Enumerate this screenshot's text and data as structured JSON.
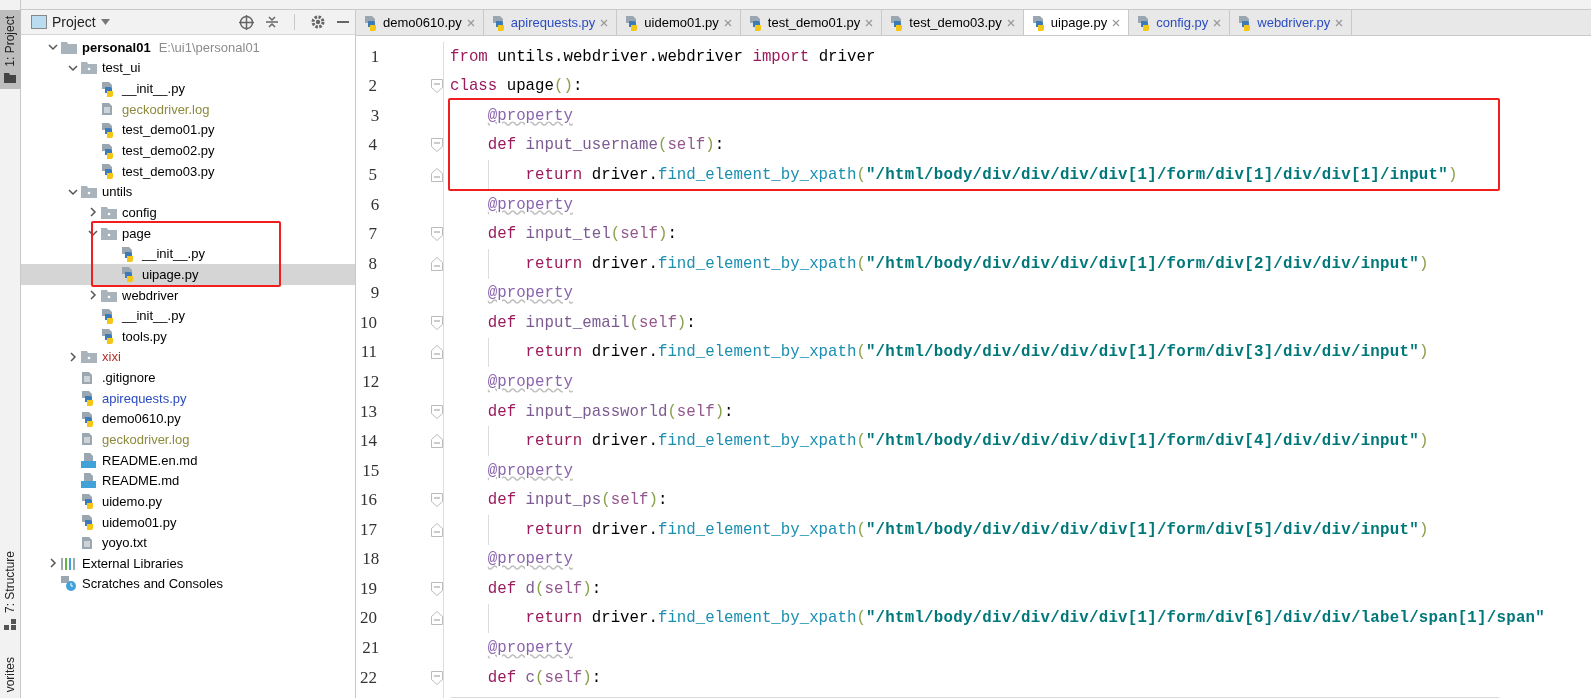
{
  "tool_stripe": [
    {
      "label": "1: Project",
      "selected": true
    },
    {
      "label": "7: Structure",
      "selected": false
    },
    {
      "label": "vorites",
      "selected": false
    }
  ],
  "project": {
    "title": "Project",
    "tree": [
      {
        "label": "personal01",
        "hint": "E:\\ui1\\personal01",
        "kind": "module",
        "expanded": true,
        "selected": false,
        "children": [
          {
            "label": "test_ui",
            "kind": "folder",
            "expanded": true,
            "selected": false,
            "children": [
              {
                "label": "__init__.py",
                "kind": "python",
                "selected": false
              },
              {
                "label": "geckodriver.log",
                "kind": "text",
                "color": "#8c8a3c",
                "selected": false
              },
              {
                "label": "test_demo01.py",
                "kind": "python",
                "selected": false
              },
              {
                "label": "test_demo02.py",
                "kind": "python",
                "selected": false
              },
              {
                "label": "test_demo03.py",
                "kind": "python",
                "selected": false
              }
            ]
          },
          {
            "label": "untils",
            "kind": "folder",
            "expanded": true,
            "selected": false,
            "children": [
              {
                "label": "config",
                "kind": "folder",
                "expanded": false,
                "selected": false
              },
              {
                "label": "page",
                "kind": "folder",
                "expanded": true,
                "selected": false,
                "boxed": true,
                "children": [
                  {
                    "label": "__init__.py",
                    "kind": "python",
                    "selected": false
                  },
                  {
                    "label": "uipage.py",
                    "kind": "python",
                    "selected": true
                  }
                ]
              },
              {
                "label": "webdriver",
                "kind": "folder",
                "expanded": false,
                "selected": false
              },
              {
                "label": "__init__.py",
                "kind": "python",
                "selected": false
              },
              {
                "label": "tools.py",
                "kind": "python",
                "selected": false
              }
            ]
          },
          {
            "label": "xixi",
            "kind": "folder",
            "expanded": false,
            "color": "#b3302b",
            "selected": false
          },
          {
            "label": ".gitignore",
            "kind": "text",
            "selected": false
          },
          {
            "label": "apirequests.py",
            "kind": "python",
            "color": "#2a4cc0",
            "selected": false
          },
          {
            "label": "demo0610.py",
            "kind": "python",
            "selected": false
          },
          {
            "label": "geckodriver.log",
            "kind": "text",
            "color": "#8c8a3c",
            "selected": false
          },
          {
            "label": "README.en.md",
            "kind": "markdown",
            "selected": false
          },
          {
            "label": "README.md",
            "kind": "markdown",
            "selected": false
          },
          {
            "label": "uidemo.py",
            "kind": "python",
            "selected": false
          },
          {
            "label": "uidemo01.py",
            "kind": "python",
            "selected": false
          },
          {
            "label": "yoyo.txt",
            "kind": "text",
            "selected": false
          }
        ]
      },
      {
        "label": "External Libraries",
        "kind": "libraries",
        "expanded": false,
        "selected": false
      },
      {
        "label": "Scratches and Consoles",
        "kind": "scratches",
        "selected": false
      }
    ]
  },
  "editor_tabs": [
    {
      "label": "demo0610.py",
      "selected": false
    },
    {
      "label": "apirequests.py",
      "selected": false,
      "color": "#2a4cc0"
    },
    {
      "label": "uidemo01.py",
      "selected": false
    },
    {
      "label": "test_demo01.py",
      "selected": false
    },
    {
      "label": "test_demo03.py",
      "selected": false
    },
    {
      "label": "uipage.py",
      "selected": true
    },
    {
      "label": "config.py",
      "selected": false,
      "color": "#2a4cc0"
    },
    {
      "label": "webdriver.py",
      "selected": false,
      "color": "#2a4cc0"
    }
  ],
  "editor": {
    "lines": [
      {
        "number": "1",
        "tokens": [
          {
            "kind": "keyword",
            "text": "from"
          },
          {
            "kind": "plain",
            "text": " untils.webdriver.webdriver "
          },
          {
            "kind": "keyword",
            "text": "import"
          },
          {
            "kind": "plain",
            "text": " driver"
          }
        ]
      },
      {
        "number": "2",
        "kind": "opener",
        "tokens": [
          {
            "kind": "keyword",
            "text": "class"
          },
          {
            "kind": "plain",
            "text": " upage"
          },
          {
            "kind": "paren",
            "text": "()"
          },
          {
            "kind": "plain",
            "text": ":"
          }
        ],
        "children": [
          {
            "number": "3",
            "boxed": true,
            "tokens": [
              {
                "kind": "decorator",
                "text": "@property"
              }
            ]
          },
          {
            "number": "4",
            "boxed": true,
            "kind": "opener",
            "tokens": [
              {
                "kind": "keyword",
                "text": "def"
              },
              {
                "kind": "name",
                "text": " input_username"
              },
              {
                "kind": "paren",
                "text": "("
              },
              {
                "kind": "self",
                "text": "self"
              },
              {
                "kind": "paren",
                "text": ")"
              },
              {
                "kind": "plain",
                "text": ":"
              }
            ],
            "children": [
              {
                "number": "5",
                "boxed": true,
                "kind": "closer",
                "tokens": [
                  {
                    "kind": "keyword",
                    "text": "return"
                  },
                  {
                    "kind": "plain",
                    "text": " driver."
                  },
                  {
                    "kind": "call",
                    "text": "find_element_by_xpath"
                  },
                  {
                    "kind": "paren",
                    "text": "("
                  },
                  {
                    "kind": "string",
                    "text": "\"/html/body/div/div/div/div[1]/form/div[1]/div/div[1]/input\""
                  },
                  {
                    "kind": "paren",
                    "text": ")"
                  }
                ]
              }
            ]
          },
          {
            "number": "6",
            "tokens": [
              {
                "kind": "decorator",
                "text": "@property"
              }
            ]
          },
          {
            "number": "7",
            "kind": "opener",
            "tokens": [
              {
                "kind": "keyword",
                "text": "def"
              },
              {
                "kind": "name",
                "text": " input_tel"
              },
              {
                "kind": "paren",
                "text": "("
              },
              {
                "kind": "self",
                "text": "self"
              },
              {
                "kind": "paren",
                "text": ")"
              },
              {
                "kind": "plain",
                "text": ":"
              }
            ],
            "children": [
              {
                "number": "8",
                "kind": "closer",
                "tokens": [
                  {
                    "kind": "keyword",
                    "text": "return"
                  },
                  {
                    "kind": "plain",
                    "text": " driver."
                  },
                  {
                    "kind": "call",
                    "text": "find_element_by_xpath"
                  },
                  {
                    "kind": "paren",
                    "text": "("
                  },
                  {
                    "kind": "string",
                    "text": "\"/html/body/div/div/div/div[1]/form/div[2]/div/div/input\""
                  },
                  {
                    "kind": "paren",
                    "text": ")"
                  }
                ]
              }
            ]
          },
          {
            "number": "9",
            "tokens": [
              {
                "kind": "decorator",
                "text": "@property"
              }
            ]
          },
          {
            "number": "10",
            "kind": "opener",
            "tokens": [
              {
                "kind": "keyword",
                "text": "def"
              },
              {
                "kind": "name",
                "text": " input_email"
              },
              {
                "kind": "paren",
                "text": "("
              },
              {
                "kind": "self",
                "text": "self"
              },
              {
                "kind": "paren",
                "text": ")"
              },
              {
                "kind": "plain",
                "text": ":"
              }
            ],
            "children": [
              {
                "number": "11",
                "kind": "closer",
                "tokens": [
                  {
                    "kind": "keyword",
                    "text": "return"
                  },
                  {
                    "kind": "plain",
                    "text": " driver."
                  },
                  {
                    "kind": "call",
                    "text": "find_element_by_xpath"
                  },
                  {
                    "kind": "paren",
                    "text": "("
                  },
                  {
                    "kind": "string",
                    "text": "\"/html/body/div/div/div/div[1]/form/div[3]/div/div/input\""
                  },
                  {
                    "kind": "paren",
                    "text": ")"
                  }
                ]
              }
            ]
          },
          {
            "number": "12",
            "tokens": [
              {
                "kind": "decorator",
                "text": "@property"
              }
            ]
          },
          {
            "number": "13",
            "kind": "opener",
            "tokens": [
              {
                "kind": "keyword",
                "text": "def"
              },
              {
                "kind": "name",
                "text": " input_passworld"
              },
              {
                "kind": "paren",
                "text": "("
              },
              {
                "kind": "self",
                "text": "self"
              },
              {
                "kind": "paren",
                "text": ")"
              },
              {
                "kind": "plain",
                "text": ":"
              }
            ],
            "children": [
              {
                "number": "14",
                "kind": "closer",
                "tokens": [
                  {
                    "kind": "keyword",
                    "text": "return"
                  },
                  {
                    "kind": "plain",
                    "text": " driver."
                  },
                  {
                    "kind": "call",
                    "text": "find_element_by_xpath"
                  },
                  {
                    "kind": "paren",
                    "text": "("
                  },
                  {
                    "kind": "string",
                    "text": "\"/html/body/div/div/div/div[1]/form/div[4]/div/div/input\""
                  },
                  {
                    "kind": "paren",
                    "text": ")"
                  }
                ]
              }
            ]
          },
          {
            "number": "15",
            "tokens": [
              {
                "kind": "decorator",
                "text": "@property"
              }
            ]
          },
          {
            "number": "16",
            "kind": "opener",
            "tokens": [
              {
                "kind": "keyword",
                "text": "def"
              },
              {
                "kind": "name",
                "text": " input_ps"
              },
              {
                "kind": "paren",
                "text": "("
              },
              {
                "kind": "self",
                "text": "self"
              },
              {
                "kind": "paren",
                "text": ")"
              },
              {
                "kind": "plain",
                "text": ":"
              }
            ],
            "children": [
              {
                "number": "17",
                "kind": "closer",
                "tokens": [
                  {
                    "kind": "keyword",
                    "text": "return"
                  },
                  {
                    "kind": "plain",
                    "text": " driver."
                  },
                  {
                    "kind": "call",
                    "text": "find_element_by_xpath"
                  },
                  {
                    "kind": "paren",
                    "text": "("
                  },
                  {
                    "kind": "string",
                    "text": "\"/html/body/div/div/div/div[1]/form/div[5]/div/div/input\""
                  },
                  {
                    "kind": "paren",
                    "text": ")"
                  }
                ]
              }
            ]
          },
          {
            "number": "18",
            "tokens": [
              {
                "kind": "decorator",
                "text": "@property"
              }
            ]
          },
          {
            "number": "19",
            "kind": "opener",
            "tokens": [
              {
                "kind": "keyword",
                "text": "def"
              },
              {
                "kind": "name",
                "text": " d"
              },
              {
                "kind": "paren",
                "text": "("
              },
              {
                "kind": "self",
                "text": "self"
              },
              {
                "kind": "paren",
                "text": ")"
              },
              {
                "kind": "plain",
                "text": ":"
              }
            ],
            "children": [
              {
                "number": "20",
                "kind": "closer",
                "tokens": [
                  {
                    "kind": "keyword",
                    "text": "return"
                  },
                  {
                    "kind": "plain",
                    "text": " driver."
                  },
                  {
                    "kind": "call",
                    "text": "find_element_by_xpath"
                  },
                  {
                    "kind": "paren",
                    "text": "("
                  },
                  {
                    "kind": "string",
                    "text": "\"/html/body/div/div/div/div[1]/form/div[6]/div/div/label/span[1]/span\""
                  }
                ]
              }
            ]
          },
          {
            "number": "21",
            "tokens": [
              {
                "kind": "decorator",
                "text": "@property"
              }
            ]
          },
          {
            "number": "22",
            "kind": "opener",
            "tokens": [
              {
                "kind": "keyword",
                "text": "def"
              },
              {
                "kind": "name",
                "text": " c"
              },
              {
                "kind": "paren",
                "text": "("
              },
              {
                "kind": "self",
                "text": "self"
              },
              {
                "kind": "paren",
                "text": ")"
              },
              {
                "kind": "plain",
                "text": ":"
              }
            ]
          }
        ]
      }
    ]
  }
}
